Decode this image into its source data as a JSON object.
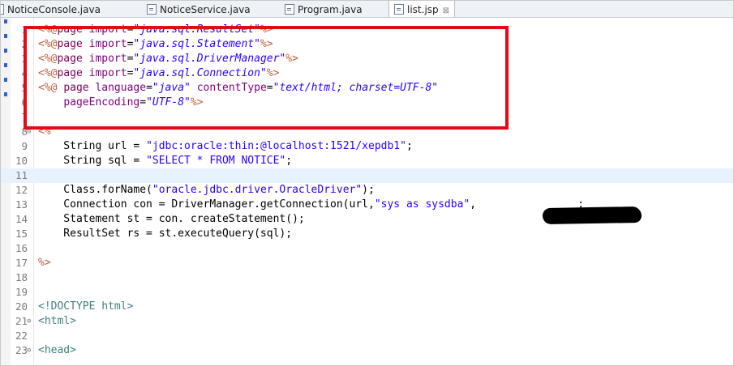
{
  "tabs": [
    {
      "label": "NoticeConsole.java",
      "active": false
    },
    {
      "label": "NoticeService.java",
      "active": false
    },
    {
      "label": "Program.java",
      "active": false
    },
    {
      "label": "list.jsp",
      "active": true
    }
  ],
  "tab_close_glyph": "⊠",
  "colors": {
    "highlight_box": "#e30a17",
    "current_line": "#e8f2fe"
  },
  "editor": {
    "lines": [
      {
        "num": "1",
        "fold": "",
        "segments": [
          {
            "c": "jsp",
            "t": "<%@"
          },
          {
            "c": "kw",
            "t": "page"
          },
          {
            "c": "",
            "t": " "
          },
          {
            "c": "attr",
            "t": "import"
          },
          {
            "c": "",
            "t": "="
          },
          {
            "c": "val",
            "t": "\"java.sql.ResultSet\""
          },
          {
            "c": "jsp",
            "t": "%>"
          }
        ]
      },
      {
        "num": "2",
        "fold": "",
        "segments": [
          {
            "c": "jsp",
            "t": "<%@"
          },
          {
            "c": "kw",
            "t": "page"
          },
          {
            "c": "",
            "t": " "
          },
          {
            "c": "attr",
            "t": "import"
          },
          {
            "c": "",
            "t": "="
          },
          {
            "c": "val",
            "t": "\"java.sql.Statement\""
          },
          {
            "c": "jsp",
            "t": "%>"
          }
        ]
      },
      {
        "num": "3",
        "fold": "",
        "segments": [
          {
            "c": "jsp",
            "t": "<%@"
          },
          {
            "c": "kw",
            "t": "page"
          },
          {
            "c": "",
            "t": " "
          },
          {
            "c": "attr",
            "t": "import"
          },
          {
            "c": "",
            "t": "="
          },
          {
            "c": "val",
            "t": "\"java.sql.DriverManager\""
          },
          {
            "c": "jsp",
            "t": "%>"
          }
        ]
      },
      {
        "num": "4",
        "fold": "",
        "segments": [
          {
            "c": "jsp",
            "t": "<%@"
          },
          {
            "c": "kw",
            "t": "page"
          },
          {
            "c": "",
            "t": " "
          },
          {
            "c": "attr",
            "t": "import"
          },
          {
            "c": "",
            "t": "="
          },
          {
            "c": "val",
            "t": "\"java.sql.Connection\""
          },
          {
            "c": "jsp",
            "t": "%>"
          }
        ]
      },
      {
        "num": "5",
        "fold": "",
        "segments": [
          {
            "c": "jsp",
            "t": "<%@"
          },
          {
            "c": "",
            "t": " "
          },
          {
            "c": "kw",
            "t": "page"
          },
          {
            "c": "",
            "t": " "
          },
          {
            "c": "attr",
            "t": "language"
          },
          {
            "c": "",
            "t": "="
          },
          {
            "c": "val",
            "t": "\"java\""
          },
          {
            "c": "",
            "t": " "
          },
          {
            "c": "attr",
            "t": "contentType"
          },
          {
            "c": "",
            "t": "="
          },
          {
            "c": "val",
            "t": "\"text/html; charset=UTF-8\""
          }
        ]
      },
      {
        "num": "6",
        "fold": "",
        "segments": [
          {
            "c": "",
            "t": "    "
          },
          {
            "c": "attr",
            "t": "pageEncoding"
          },
          {
            "c": "",
            "t": "="
          },
          {
            "c": "val",
            "t": "\"UTF-8\""
          },
          {
            "c": "jsp",
            "t": "%>"
          }
        ]
      },
      {
        "num": "7",
        "fold": "",
        "segments": []
      },
      {
        "num": "8",
        "fold": "⊖",
        "segments": [
          {
            "c": "jsp",
            "t": "<%"
          }
        ]
      },
      {
        "num": "9",
        "fold": "",
        "segments": [
          {
            "c": "",
            "t": "    String url = "
          },
          {
            "c": "str",
            "t": "\"jdbc:oracle:thin:@localhost:1521/xepdb1\""
          },
          {
            "c": "",
            "t": ";"
          }
        ]
      },
      {
        "num": "10",
        "fold": "",
        "segments": [
          {
            "c": "",
            "t": "    String sql = "
          },
          {
            "c": "str",
            "t": "\"SELECT * FROM NOTICE\""
          },
          {
            "c": "",
            "t": ";"
          }
        ]
      },
      {
        "num": "11",
        "fold": "",
        "current": true,
        "segments": []
      },
      {
        "num": "12",
        "fold": "",
        "segments": [
          {
            "c": "",
            "t": "    Class.forName("
          },
          {
            "c": "str",
            "t": "\"oracle.jdbc.driver.OracleDriver\""
          },
          {
            "c": "",
            "t": ");"
          }
        ]
      },
      {
        "num": "13",
        "fold": "",
        "segments": [
          {
            "c": "",
            "t": "    Connection con = DriverManager.getConnection(url,"
          },
          {
            "c": "str",
            "t": "\"sys as sysdba\""
          },
          {
            "c": "",
            "t": ",                ;"
          }
        ]
      },
      {
        "num": "14",
        "fold": "",
        "segments": [
          {
            "c": "",
            "t": "    Statement st = con. createStatement();"
          }
        ]
      },
      {
        "num": "15",
        "fold": "",
        "segments": [
          {
            "c": "",
            "t": "    ResultSet rs = st.executeQuery(sql);"
          }
        ]
      },
      {
        "num": "16",
        "fold": "",
        "segments": []
      },
      {
        "num": "17",
        "fold": "",
        "segments": [
          {
            "c": "jsp",
            "t": "%>"
          }
        ]
      },
      {
        "num": "18",
        "fold": "",
        "segments": []
      },
      {
        "num": "19",
        "fold": "",
        "segments": []
      },
      {
        "num": "20",
        "fold": "",
        "segments": [
          {
            "c": "tag",
            "t": "<!DOCTYPE html>"
          }
        ]
      },
      {
        "num": "21",
        "fold": "⊖",
        "segments": [
          {
            "c": "tag",
            "t": "<html>"
          }
        ]
      },
      {
        "num": "22",
        "fold": "",
        "segments": []
      },
      {
        "num": "23",
        "fold": "⊖",
        "segments": [
          {
            "c": "tag",
            "t": "<head>"
          }
        ]
      }
    ]
  }
}
